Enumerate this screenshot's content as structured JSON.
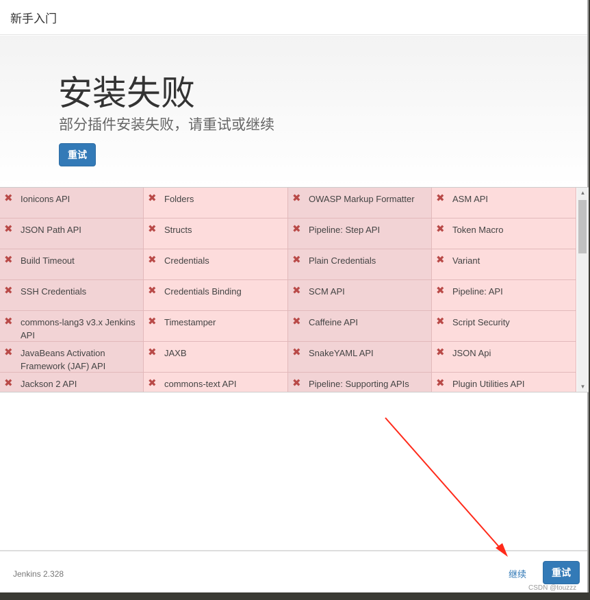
{
  "header": {
    "title": "新手入门"
  },
  "hero": {
    "title": "安装失败",
    "subtitle": "部分插件安装失败，请重试或继续",
    "retry_label": "重试"
  },
  "plugins": [
    "Ionicons API",
    "Folders",
    "OWASP Markup Formatter",
    "ASM API",
    "JSON Path API",
    "Structs",
    "Pipeline: Step API",
    "Token Macro",
    "Build Timeout",
    "Credentials",
    "Plain Credentials",
    "Variant",
    "SSH Credentials",
    "Credentials Binding",
    "SCM API",
    "Pipeline: API",
    "commons-lang3 v3.x Jenkins API",
    "Timestamper",
    "Caffeine API",
    "Script Security",
    "JavaBeans Activation Framework (JAF) API",
    "JAXB",
    "SnakeYAML API",
    "JSON Api",
    "Jackson 2 API",
    "commons-text API",
    "Pipeline: Supporting APIs",
    "Plugin Utilities API"
  ],
  "plugin_status_icon": "fail-x-icon",
  "footer": {
    "version": "Jenkins 2.328",
    "continue_label": "继续",
    "retry_label": "重试"
  },
  "watermark": "CSDN @touzzz",
  "colors": {
    "primary": "#337ab7",
    "fail": "#b94a48",
    "cell_dark": "#f2d3d5",
    "cell_light": "#fddcdc",
    "annotation": "#ff2a1a"
  }
}
